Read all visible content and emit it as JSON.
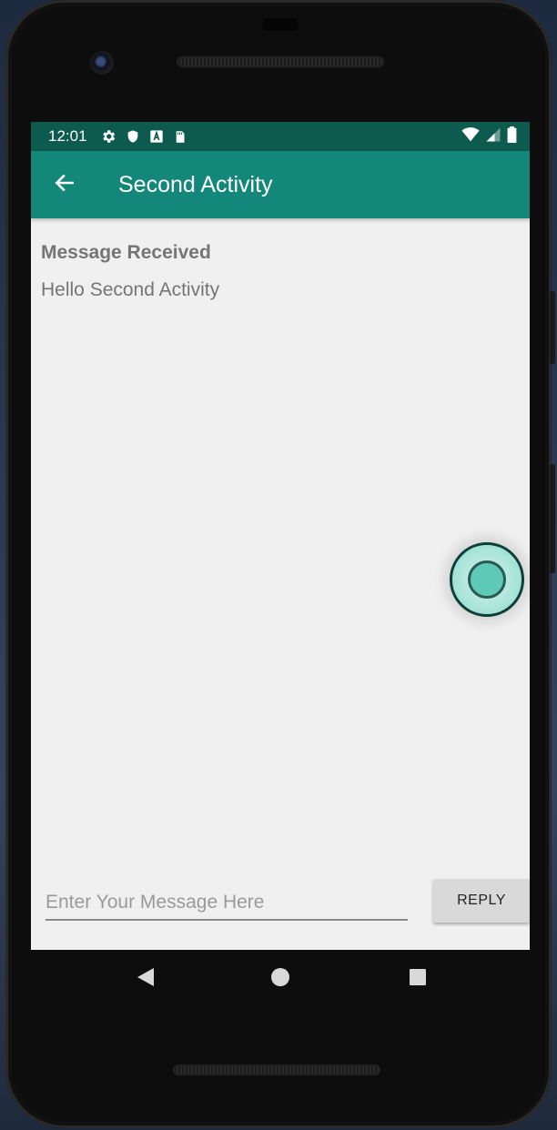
{
  "status_bar": {
    "time": "12:01",
    "icons_left": [
      "gear-icon",
      "shield-icon",
      "a-badge-icon",
      "sd-card-icon"
    ],
    "icons_right": [
      "wifi-icon",
      "signal-icon",
      "battery-icon"
    ]
  },
  "app_bar": {
    "title": "Second Activity",
    "background": "#12877a",
    "status_background": "#0d5a4f"
  },
  "content": {
    "header": "Message Received",
    "message": "Hello Second Activity"
  },
  "compose": {
    "placeholder": "Enter Your Message Here",
    "value": "",
    "reply_label": "REPLY"
  },
  "nav": {
    "buttons": [
      "back-icon",
      "home-icon",
      "recents-icon"
    ]
  }
}
